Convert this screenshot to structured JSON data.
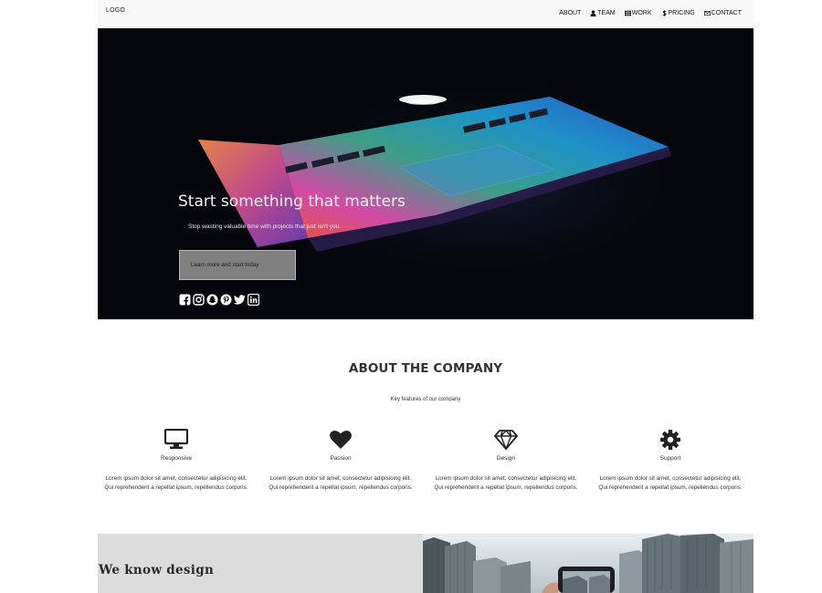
{
  "nav": {
    "logo": "LOGO",
    "links": [
      {
        "label": "ABOUT",
        "icon": ""
      },
      {
        "label": "TEAM",
        "icon": "user-icon"
      },
      {
        "label": "WORK",
        "icon": "grid-icon"
      },
      {
        "label": "PRICING",
        "icon": "dollar-icon"
      },
      {
        "label": "CONTACT",
        "icon": "envelope-icon"
      }
    ]
  },
  "hero": {
    "title": "Start something that matters",
    "subtitle": "Stop wasting valuable time with projects that just isn't you.",
    "button_label": "Learn more and start today",
    "social_icons": [
      "facebook-icon",
      "instagram-icon",
      "snapchat-icon",
      "pinterest-icon",
      "twitter-icon",
      "linkedin-icon"
    ]
  },
  "about": {
    "title": "ABOUT THE COMPANY",
    "subtitle": "Key features of our company",
    "features": [
      {
        "name": "Responsive",
        "icon": "desktop-icon",
        "text": "Lorem ipsum dolor sit amet, consectetur adipisicing elit. Qui reprehenderit a repellat ipsum, repellendus corporis."
      },
      {
        "name": "Passion",
        "icon": "heart-icon",
        "text": "Lorem ipsum dolor sit amet, consectetur adipisicing elit. Qui reprehenderit a repellat ipsum, repellendus corporis."
      },
      {
        "name": "Design",
        "icon": "diamond-icon",
        "text": "Lorem ipsum dolor sit amet, consectetur adipisicing elit. Qui reprehenderit a repellat ipsum, repellendus corporis."
      },
      {
        "name": "Support",
        "icon": "gear-icon",
        "text": "Lorem ipsum dolor sit amet, consectetur adipisicing elit. Qui reprehenderit a repellat ipsum, repellendus corporis."
      }
    ]
  },
  "section2": {
    "title": "We know design"
  },
  "colors": {
    "nav_bg": "#f8f8f8",
    "hero_bg": "#05060b",
    "button_bg": "#969696",
    "bottom_left_bg": "#dcdcdc",
    "text": "#333333"
  }
}
